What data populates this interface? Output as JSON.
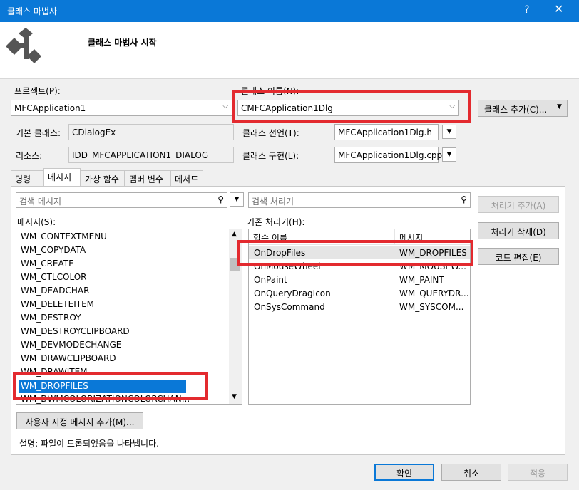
{
  "window": {
    "title": "클래스 마법사",
    "help": "?",
    "close": "✕"
  },
  "header": {
    "heading": "클래스 마법사 시작"
  },
  "project": {
    "label": "프로젝트(P):",
    "value": "MFCApplication1"
  },
  "class_name": {
    "label": "클래스 이름(N):",
    "value": "CMFCApplication1Dlg"
  },
  "add_class": {
    "label": "클래스 추가(C)..."
  },
  "base_class": {
    "label": "기본 클래스:",
    "value": "CDialogEx"
  },
  "class_decl": {
    "label": "클래스 선언(T):",
    "value": "MFCApplication1Dlg.h"
  },
  "resource": {
    "label": "리소스:",
    "value": "IDD_MFCAPPLICATION1_DIALOG"
  },
  "class_impl": {
    "label": "클래스 구현(L):",
    "value": "MFCApplication1Dlg.cpp"
  },
  "tabs": [
    "명령",
    "메시지",
    "가상 함수",
    "멤버 변수",
    "메서드"
  ],
  "messages": {
    "search_placeholder": "검색 메시지",
    "label": "메시지(S):",
    "items": [
      "WM_CONTEXTMENU",
      "WM_COPYDATA",
      "WM_CREATE",
      "WM_CTLCOLOR",
      "WM_DEADCHAR",
      "WM_DELETEITEM",
      "WM_DESTROY",
      "WM_DESTROYCLIPBOARD",
      "WM_DEVMODECHANGE",
      "WM_DRAWCLIPBOARD",
      "WM_DRAWITEM",
      "WM_DROPFILES",
      "WM_DWMCOLORIZATIONCOLORCHAN..."
    ],
    "selected": "WM_DROPFILES"
  },
  "handlers": {
    "search_placeholder": "검색 처리기",
    "label": "기존 처리기(H):",
    "col_function": "함수 이름",
    "col_message": "메시지",
    "rows": [
      {
        "fn": "OnDropFiles",
        "msg": "WM_DROPFILES"
      },
      {
        "fn": "OnMouseWheel",
        "msg": "WM_MOUSEW..."
      },
      {
        "fn": "OnPaint",
        "msg": "WM_PAINT"
      },
      {
        "fn": "OnQueryDragIcon",
        "msg": "WM_QUERYDR..."
      },
      {
        "fn": "OnSysCommand",
        "msg": "WM_SYSCOM..."
      }
    ]
  },
  "side_buttons": {
    "add_handler": "처리기 추가(A)",
    "delete_handler": "처리기 삭제(D)",
    "edit_code": "코드 편집(E)"
  },
  "add_custom": "사용자 지정 메시지 추가(M)...",
  "description": "설명:   파일이 드롭되었음을 나타냅니다.",
  "footer": {
    "ok": "확인",
    "cancel": "취소",
    "apply": "적용"
  },
  "colors": {
    "accent": "#0a78d7",
    "highlight": "#e32a2f"
  }
}
